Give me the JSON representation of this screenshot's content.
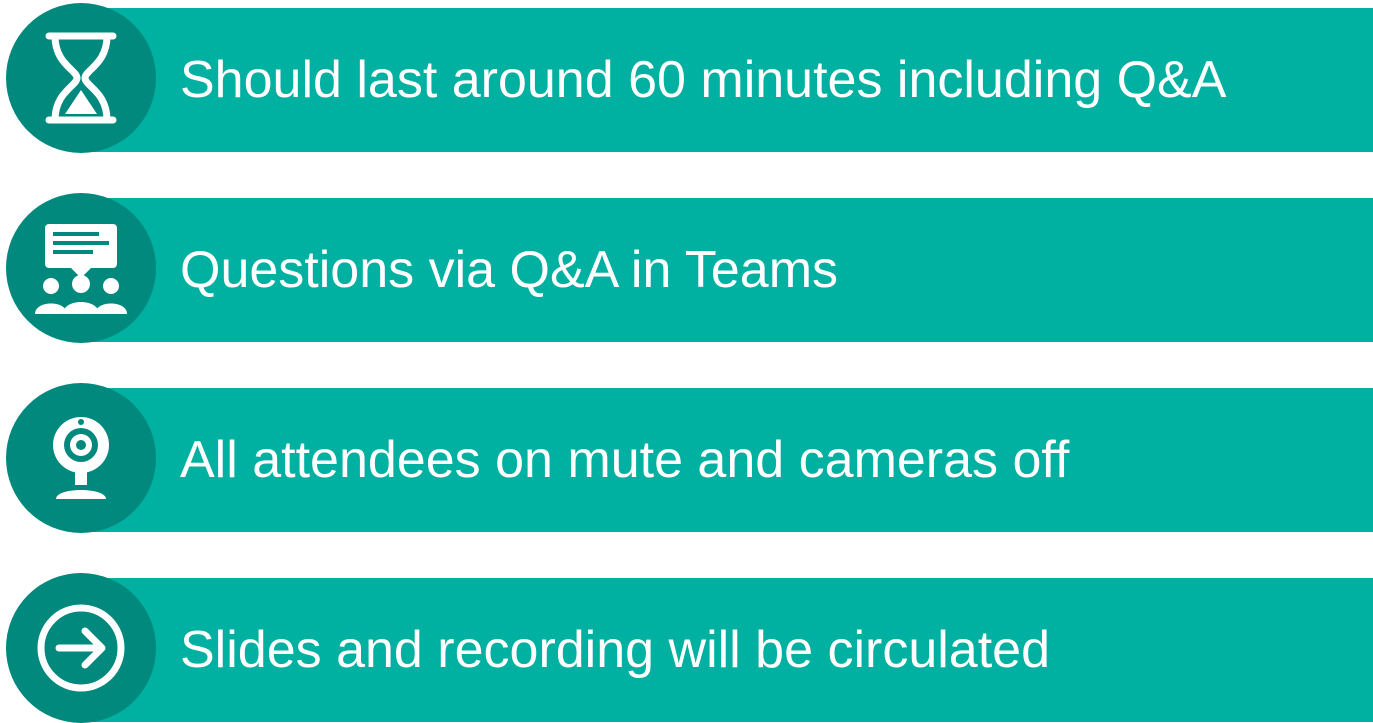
{
  "colors": {
    "bar": "#00b0a0",
    "icon_circle": "#00897c",
    "text": "#ffffff"
  },
  "items": [
    {
      "icon": "hourglass-icon",
      "text": "Should last around 60 minutes including Q&A"
    },
    {
      "icon": "audience-speech-bubble-icon",
      "text": "Questions via Q&A in Teams"
    },
    {
      "icon": "webcam-icon",
      "text": "All attendees on mute and cameras off"
    },
    {
      "icon": "arrow-right-circle-icon",
      "text": "Slides and recording will be circulated"
    }
  ]
}
